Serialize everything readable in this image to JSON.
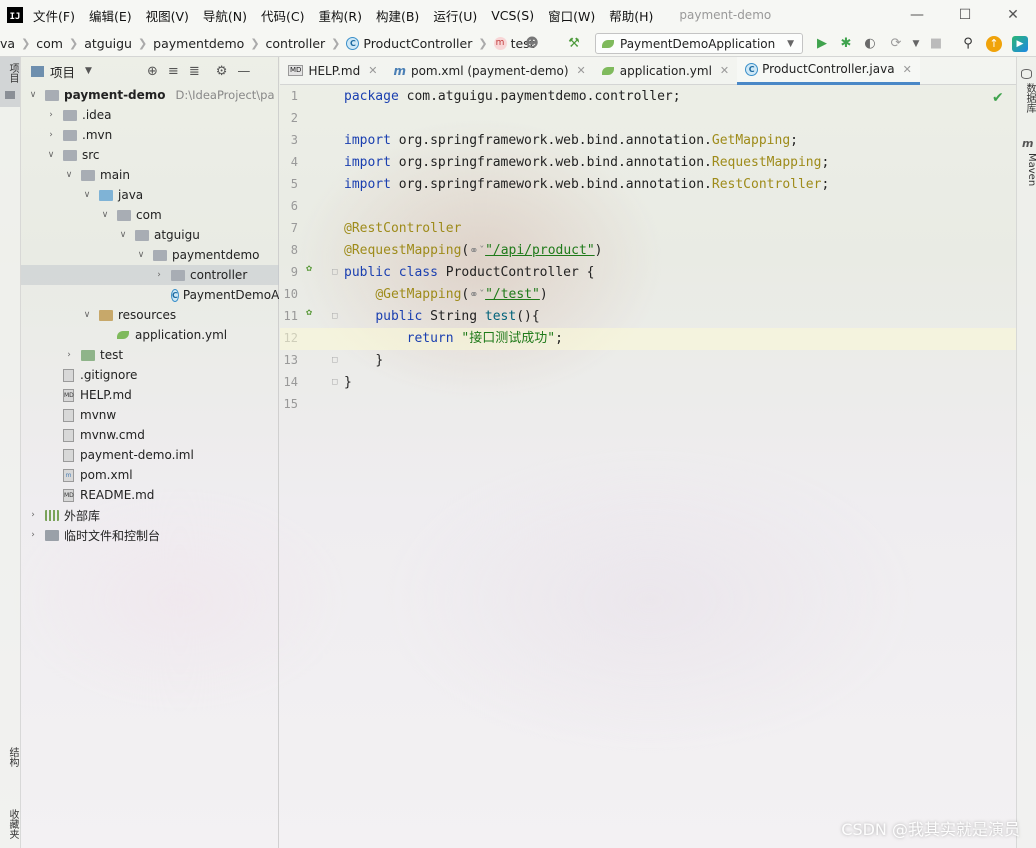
{
  "menu": {
    "app_logo": "IJ",
    "items": [
      "文件(F)",
      "编辑(E)",
      "视图(V)",
      "导航(N)",
      "代码(C)",
      "重构(R)",
      "构建(B)",
      "运行(U)",
      "VCS(S)",
      "窗口(W)",
      "帮助(H)"
    ],
    "window_title": "payment-demo"
  },
  "breadcrumb": {
    "items": [
      "va",
      "com",
      "atguigu",
      "paymentdemo",
      "controller",
      "ProductController",
      "test"
    ],
    "class_icon_letter": "C",
    "method_icon_letter": "m"
  },
  "toolbar": {
    "run_config": "PaymentDemoApplication"
  },
  "left_strip": {
    "project_tab": "项目",
    "structure_tab": "结构",
    "favorites_tab": "收藏夹"
  },
  "right_strip": {
    "database_tab": "数据库",
    "maven_tab": "Maven"
  },
  "project_panel": {
    "title": "项目",
    "tree": [
      {
        "label": "payment-demo",
        "hint": "D:\\IdeaProject\\pa",
        "depth": 0,
        "arrow": "open",
        "icon": "folder",
        "bold": true
      },
      {
        "label": ".idea",
        "depth": 1,
        "arrow": "closed",
        "icon": "folder"
      },
      {
        "label": ".mvn",
        "depth": 1,
        "arrow": "closed",
        "icon": "folder"
      },
      {
        "label": "src",
        "depth": 1,
        "arrow": "open",
        "icon": "folder"
      },
      {
        "label": "main",
        "depth": 2,
        "arrow": "open",
        "icon": "folder"
      },
      {
        "label": "java",
        "depth": 3,
        "arrow": "open",
        "icon": "folder-blue"
      },
      {
        "label": "com",
        "depth": 4,
        "arrow": "open",
        "icon": "folder"
      },
      {
        "label": "atguigu",
        "depth": 5,
        "arrow": "open",
        "icon": "folder"
      },
      {
        "label": "paymentdemo",
        "depth": 6,
        "arrow": "open",
        "icon": "folder"
      },
      {
        "label": "controller",
        "depth": 7,
        "arrow": "closed",
        "icon": "folder",
        "selected": true
      },
      {
        "label": "PaymentDemoAp",
        "depth": 7,
        "arrow": "none",
        "icon": "class"
      },
      {
        "label": "resources",
        "depth": 3,
        "arrow": "open",
        "icon": "folder-res"
      },
      {
        "label": "application.yml",
        "depth": 4,
        "arrow": "none",
        "icon": "yml"
      },
      {
        "label": "test",
        "depth": 2,
        "arrow": "closed",
        "icon": "folder-test"
      },
      {
        "label": ".gitignore",
        "depth": 1,
        "arrow": "none",
        "icon": "file"
      },
      {
        "label": "HELP.md",
        "depth": 1,
        "arrow": "none",
        "icon": "md"
      },
      {
        "label": "mvnw",
        "depth": 1,
        "arrow": "none",
        "icon": "file"
      },
      {
        "label": "mvnw.cmd",
        "depth": 1,
        "arrow": "none",
        "icon": "file"
      },
      {
        "label": "payment-demo.iml",
        "depth": 1,
        "arrow": "none",
        "icon": "file"
      },
      {
        "label": "pom.xml",
        "depth": 1,
        "arrow": "none",
        "icon": "maven"
      },
      {
        "label": "README.md",
        "depth": 1,
        "arrow": "none",
        "icon": "md"
      },
      {
        "label": "外部库",
        "depth": 0,
        "arrow": "closed",
        "icon": "lib"
      },
      {
        "label": "临时文件和控制台",
        "depth": 0,
        "arrow": "closed",
        "icon": "scratch"
      }
    ]
  },
  "editor": {
    "tabs": [
      {
        "label": "HELP.md",
        "icon": "md",
        "active": false
      },
      {
        "label": "pom.xml (payment-demo)",
        "icon": "maven",
        "active": false
      },
      {
        "label": "application.yml",
        "icon": "yml",
        "active": false
      },
      {
        "label": "ProductController.java",
        "icon": "class",
        "active": true
      }
    ],
    "line_numbers": [
      "1",
      "2",
      "3",
      "4",
      "5",
      "6",
      "7",
      "8",
      "9",
      "10",
      "11",
      "12",
      "13",
      "14",
      "15"
    ],
    "current_line": 12,
    "code": {
      "l1_kw": "package",
      "l1_rest": " com.atguigu.paymentdemo.controller;",
      "l3_kw": "import",
      "l3_pkg": " org.springframework.web.bind.annotation.",
      "l3_cls": "GetMapping",
      "l4_kw": "import",
      "l4_pkg": " org.springframework.web.bind.annotation.",
      "l4_cls": "RequestMapping",
      "l5_kw": "import",
      "l5_pkg": " org.springframework.web.bind.annotation.",
      "l5_cls": "RestController",
      "l7_ann": "@RestController",
      "l8_ann": "@RequestMapping",
      "l8_str": "\"/api/product\"",
      "l9_kw": "public class",
      "l9_rest": " ProductController {",
      "l10_ann": "@GetMapping",
      "l10_str": "\"/test\"",
      "l11_kw": "public",
      "l11_type": " String ",
      "l11_fn": "test",
      "l11_rest": "(){",
      "l12_kw": "return",
      "l12_str": "\"接口测试成功\"",
      "l13": "}",
      "l14": "}"
    }
  },
  "watermark": "CSDN @我其实就是演员",
  "colors": {
    "keyword": "#1a3fb0",
    "annotation": "#9e8b1a",
    "string": "#1f7a1a",
    "function": "#00627a",
    "accent": "#4a88c7"
  }
}
